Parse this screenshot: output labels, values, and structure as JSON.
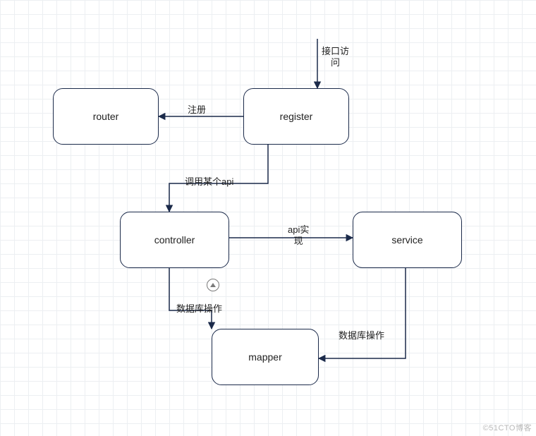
{
  "nodes": {
    "router": {
      "label": "router"
    },
    "register": {
      "label": "register"
    },
    "controller": {
      "label": "controller"
    },
    "service": {
      "label": "service"
    },
    "mapper": {
      "label": "mapper"
    }
  },
  "edges": {
    "entry_to_register": {
      "label": "接口访\n问"
    },
    "register_to_router": {
      "label": "注册"
    },
    "register_to_controller": {
      "label": "调用某个api"
    },
    "controller_to_service": {
      "label": "api实\n现"
    },
    "controller_to_mapper": {
      "label": "数据库操作"
    },
    "service_to_mapper": {
      "label": "数据库操作"
    }
  },
  "watermark": "©51CTO博客"
}
